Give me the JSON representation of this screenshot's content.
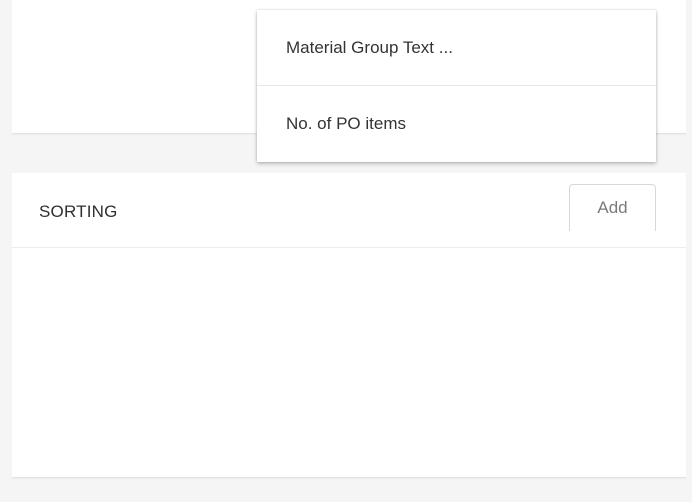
{
  "dropdown": {
    "items": [
      {
        "label": "Material Group Text ..."
      },
      {
        "label": "No. of PO items"
      }
    ]
  },
  "sorting": {
    "title": "SORTING",
    "add_label": "Add"
  },
  "colors": {
    "page_background": "#f5f5f5",
    "panel_background": "#ffffff",
    "divider": "#ececec",
    "button_border": "#d8d8d8"
  }
}
